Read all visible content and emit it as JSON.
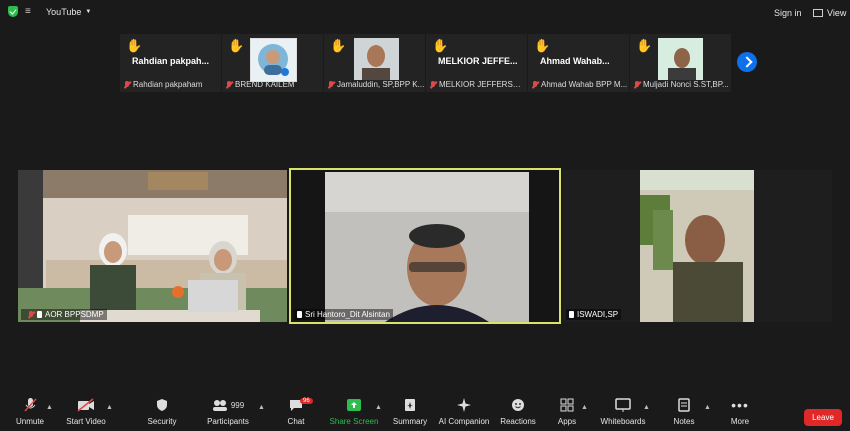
{
  "topbar": {
    "stream_label": "YouTube",
    "signin_label": "Sign in",
    "view_label": "View"
  },
  "thumbnails": [
    {
      "big_name": "Rahdian pakpah...",
      "label": "Rahdian pakpaham",
      "raised_hand": true
    },
    {
      "big_name": "",
      "label": "BREND KAILEM",
      "raised_hand": true
    },
    {
      "big_name": "",
      "label": "Jamaluddin, SP,BPP K...",
      "raised_hand": true
    },
    {
      "big_name": "MELKIOR JEFFE...",
      "label": "MELKIOR JEFFERSON...",
      "raised_hand": true
    },
    {
      "big_name": "Ahmad Wahab...",
      "label": "Ahmad Wahab BPP M...",
      "raised_hand": true
    },
    {
      "big_name": "",
      "label": "Muljadi Nonci S.ST,BP...",
      "raised_hand": true
    }
  ],
  "videos": [
    {
      "name": "AOR BPPSDMP"
    },
    {
      "name": "Sri Hantoro_Dit Alsintan"
    },
    {
      "name": "ISWADI,SP"
    }
  ],
  "toolbar": {
    "unmute": "Unmute",
    "start_video": "Start Video",
    "security": "Security",
    "participants": "Participants",
    "participants_count": "999",
    "chat": "Chat",
    "chat_badge": "96",
    "share_screen": "Share Screen",
    "summary": "Summary",
    "ai_companion": "AI Companion",
    "reactions": "Reactions",
    "apps": "Apps",
    "whiteboards": "Whiteboards",
    "notes": "Notes",
    "more": "More",
    "leave": "Leave"
  },
  "colors": {
    "background": "#1a1a1a",
    "active_speaker_border": "#d7e36b",
    "share_green": "#2dbd4e",
    "leave_red": "#e02828",
    "hand_yellow": "#f2c030"
  }
}
